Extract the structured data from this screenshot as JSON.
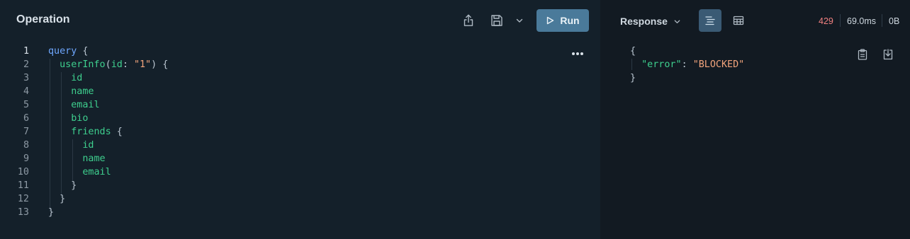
{
  "operation": {
    "title": "Operation",
    "run_label": "Run",
    "icons": {
      "share": "share-icon",
      "save": "save-icon",
      "save_menu": "chevron-down-icon",
      "run": "play-icon",
      "more": "more-icon"
    },
    "lines": [
      {
        "num": "1",
        "tokens": [
          {
            "t": "query",
            "c": "kw"
          },
          {
            "t": " {",
            "c": "pun"
          }
        ]
      },
      {
        "num": "2",
        "tokens": [
          {
            "t": "  userInfo",
            "c": "fld"
          },
          {
            "t": "(",
            "c": "pun"
          },
          {
            "t": "id",
            "c": "fld"
          },
          {
            "t": ": ",
            "c": "pun"
          },
          {
            "t": "\"1\"",
            "c": "str"
          },
          {
            "t": ") {",
            "c": "pun"
          }
        ]
      },
      {
        "num": "3",
        "tokens": [
          {
            "t": "    id",
            "c": "fld"
          }
        ]
      },
      {
        "num": "4",
        "tokens": [
          {
            "t": "    name",
            "c": "fld"
          }
        ]
      },
      {
        "num": "5",
        "tokens": [
          {
            "t": "    email",
            "c": "fld"
          }
        ]
      },
      {
        "num": "6",
        "tokens": [
          {
            "t": "    bio",
            "c": "fld"
          }
        ]
      },
      {
        "num": "7",
        "tokens": [
          {
            "t": "    friends",
            "c": "fld"
          },
          {
            "t": " {",
            "c": "pun"
          }
        ]
      },
      {
        "num": "8",
        "tokens": [
          {
            "t": "      id",
            "c": "fld"
          }
        ]
      },
      {
        "num": "9",
        "tokens": [
          {
            "t": "      name",
            "c": "fld"
          }
        ]
      },
      {
        "num": "10",
        "tokens": [
          {
            "t": "      email",
            "c": "fld"
          }
        ]
      },
      {
        "num": "11",
        "tokens": [
          {
            "t": "    }",
            "c": "pun"
          }
        ]
      },
      {
        "num": "12",
        "tokens": [
          {
            "t": "  }",
            "c": "pun"
          }
        ]
      },
      {
        "num": "13",
        "tokens": [
          {
            "t": "}",
            "c": "pun"
          }
        ]
      }
    ]
  },
  "response": {
    "title": "Response",
    "status_code": "429",
    "time": "69.0ms",
    "size": "0B",
    "icons": {
      "menu": "chevron-down-icon",
      "text_view": "text-view-icon",
      "table_view": "table-view-icon",
      "copy": "copy-icon",
      "download": "download-icon"
    },
    "lines": [
      [
        {
          "t": "{",
          "c": "pun"
        }
      ],
      [
        {
          "t": "  ",
          "c": "pun"
        },
        {
          "t": "\"error\"",
          "c": "fld"
        },
        {
          "t": ": ",
          "c": "pun"
        },
        {
          "t": "\"BLOCKED\"",
          "c": "str"
        }
      ],
      [
        {
          "t": "}",
          "c": "pun"
        }
      ]
    ]
  },
  "colors": {
    "keyword": "#6fa8ff",
    "field": "#3ecf8e",
    "string": "#f2a47c",
    "status_error": "#f08080",
    "run_button": "#4a7a9a"
  }
}
